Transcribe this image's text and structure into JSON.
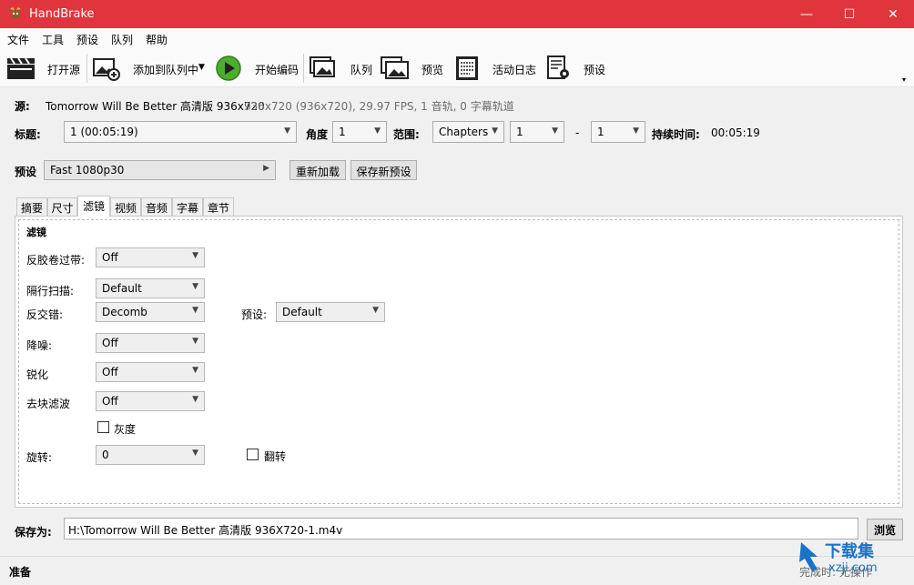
{
  "window": {
    "title": "HandBrake",
    "minimize": "—",
    "maximize": "☐",
    "close": "✕"
  },
  "menu": [
    "文件",
    "工具",
    "预设",
    "队列",
    "帮助"
  ],
  "toolbar": {
    "open_source": "打开源",
    "add_to_queue": "添加到队列中",
    "start_encode": "开始编码",
    "queue": "队列",
    "preview": "预览",
    "activity_log": "活动日志",
    "presets": "预设"
  },
  "source": {
    "label": "源:",
    "name": "Tomorrow Will Be Better 高清版 936x720",
    "info": "936x720 (936x720), 29.97 FPS, 1 音轨, 0 字幕轨道"
  },
  "title_row": {
    "title_label": "标题:",
    "title_value": "1 (00:05:19)",
    "angle_label": "角度",
    "angle_value": "1",
    "range_label": "范围:",
    "range_type": "Chapters",
    "range_from": "1",
    "range_dash": "-",
    "range_to": "1",
    "duration_label": "持续时间:",
    "duration_value": "00:05:19"
  },
  "preset_row": {
    "label": "预设",
    "value": "Fast 1080p30",
    "reload": "重新加载",
    "save_new": "保存新预设"
  },
  "tabs": [
    "摘要",
    "尺寸",
    "滤镜",
    "视频",
    "音频",
    "字幕",
    "章节"
  ],
  "active_tab": "滤镜",
  "filters": {
    "heading": "滤镜",
    "detelecine_label": "反胶卷过带:",
    "detelecine_value": "Off",
    "interlace_label": "隔行扫描:",
    "interlace_value": "Default",
    "deinterlace_label": "反交错:",
    "deinterlace_value": "Decomb",
    "deint_preset_label": "预设:",
    "deint_preset_value": "Default",
    "denoise_label": "降噪:",
    "denoise_value": "Off",
    "sharpen_label": "锐化",
    "sharpen_value": "Off",
    "deblock_label": "去块滤波",
    "deblock_value": "Off",
    "grayscale_label": "灰度",
    "rotate_label": "旋转:",
    "rotate_value": "0",
    "flip_label": "翻转"
  },
  "save": {
    "label": "保存为:",
    "path": "H:\\Tomorrow Will Be Better 高清版 936X720-1.m4v",
    "browse": "浏览"
  },
  "status": {
    "text": "准备",
    "right_text": "完成时: 无操作"
  },
  "watermark": {
    "text": "下载集",
    "sub": "xzji.com"
  },
  "colors": {
    "titlebar": "#e0353c",
    "play_green": "#4cae2c",
    "watermark_blue": "#1a73c8"
  }
}
